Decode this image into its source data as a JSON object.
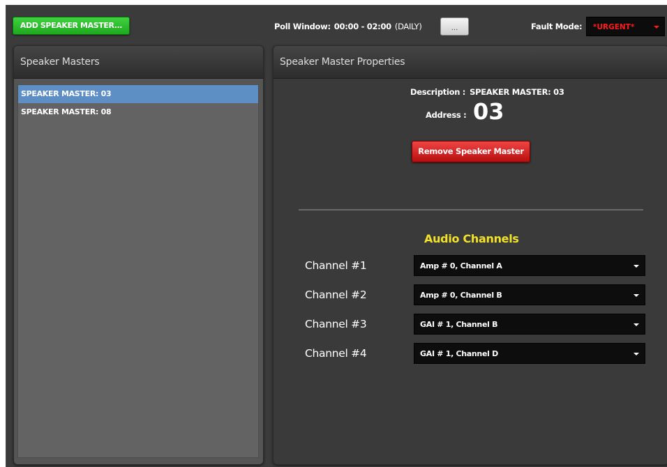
{
  "toolbar": {
    "add_button_label": "ADD SPEAKER MASTER...",
    "poll_window_label": "Poll Window:",
    "poll_window_range": "00:00 - 02:00",
    "poll_window_frequency": "(DAILY)",
    "poll_window_button_label": "...",
    "fault_mode_label": "Fault Mode:",
    "fault_mode_value": "*URGENT*"
  },
  "speaker_masters": {
    "title": "Speaker Masters",
    "items": [
      {
        "label": "SPEAKER MASTER: 03",
        "selected": true
      },
      {
        "label": "SPEAKER MASTER: 08",
        "selected": false
      }
    ]
  },
  "properties": {
    "title": "Speaker Master Properties",
    "description_label": "Description :",
    "description_value": "SPEAKER MASTER: 03",
    "address_label": "Address :",
    "address_value": "03",
    "remove_button_label": "Remove Speaker Master",
    "audio_channels_title": "Audio Channels",
    "channels": [
      {
        "label": "Channel #1",
        "value": "Amp # 0, Channel A"
      },
      {
        "label": "Channel #2",
        "value": "Amp # 0, Channel B"
      },
      {
        "label": "Channel #3",
        "value": "GAI # 1, Channel B"
      },
      {
        "label": "Channel #4",
        "value": "GAI # 1, Channel D"
      }
    ]
  },
  "colors": {
    "add_button": "#2ebf2e",
    "remove_button": "#d92525",
    "fault_mode_text": "#ff1a1a",
    "selected_item": "#5e8fc4",
    "audio_title": "#f2e32a"
  }
}
